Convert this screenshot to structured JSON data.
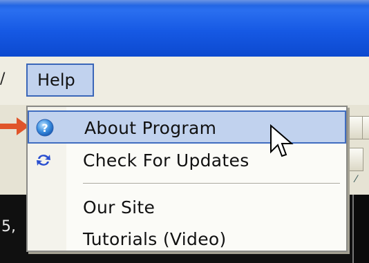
{
  "menubar": {
    "prev_item_fragment": "/",
    "help_label": "Help"
  },
  "dropdown": {
    "items": [
      {
        "label": "About Program",
        "icon": "help-icon",
        "highlighted": true
      },
      {
        "label": "Check For Updates",
        "icon": "refresh-icon",
        "highlighted": false
      },
      {
        "label": "Our Site",
        "icon": null,
        "highlighted": false
      },
      {
        "label": "Tutorials (Video)",
        "icon": null,
        "highlighted": false
      }
    ]
  },
  "background": {
    "fragment_text": "5,"
  },
  "colors": {
    "titlebar": "#1659e4",
    "highlight": "#c1d2ee",
    "highlight_border": "#3f6cc0",
    "arrow": "#e0552a"
  }
}
